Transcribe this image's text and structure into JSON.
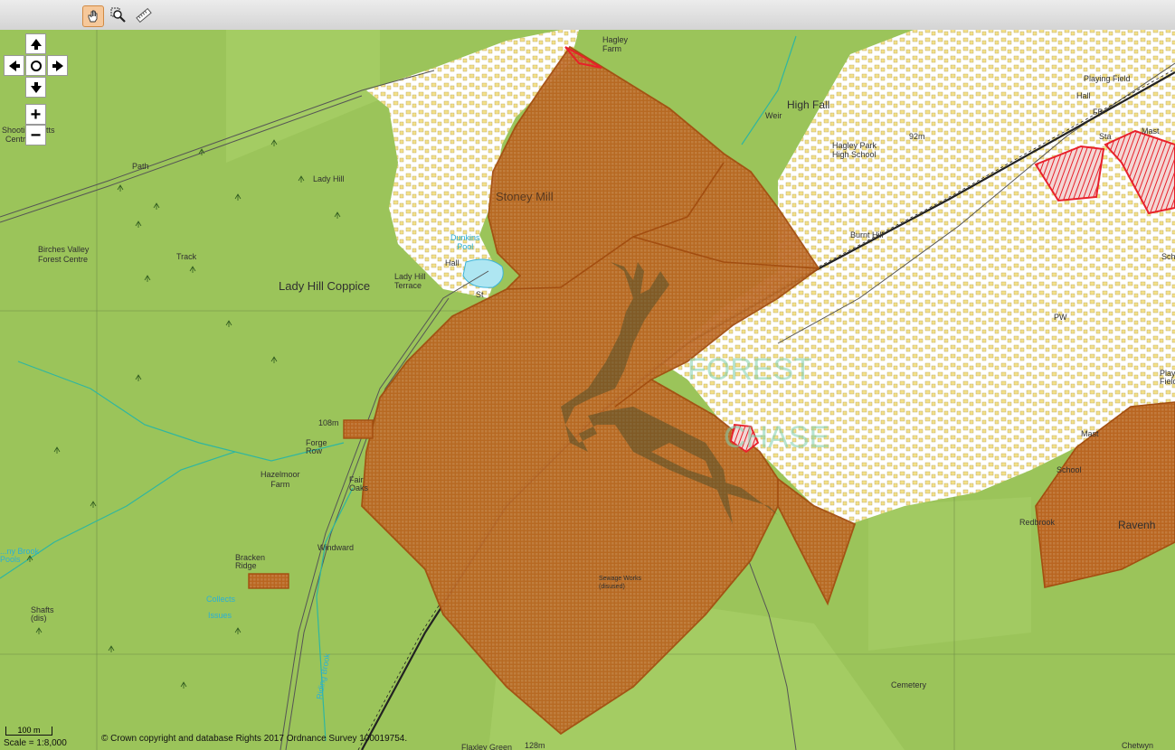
{
  "toolbar": {
    "tools": [
      {
        "name": "pan-hand-icon",
        "active": true
      },
      {
        "name": "zoom-box-icon",
        "active": false
      },
      {
        "name": "measure-ruler-icon",
        "active": false
      }
    ]
  },
  "navigation": {
    "up": "pan-up-arrow-icon",
    "down": "pan-down-arrow-icon",
    "left": "pan-left-arrow-icon",
    "right": "pan-right-arrow-icon",
    "center": "recenter-circle-icon",
    "zoom_in": "+",
    "zoom_out": "−"
  },
  "map": {
    "colors": {
      "forest": "#9bc45a",
      "urban": "#ffffff",
      "building": "#f3e08a",
      "hatch_brown": "#b5560f",
      "hatch_red": "#e8202a",
      "water": "#aee6f2"
    },
    "labels": {
      "shooting_butts": "Shooting Butts",
      "centre": "Centre",
      "lady_hill": "Lady Hill",
      "birches_valley": "Birches Valley",
      "forest_centre": "Forest Centre",
      "lady_hill_coppice": "Lady Hill Coppice",
      "lady_hill_terrace": "Lady Hill\nTerrace",
      "stoney_mill": "Stoney Mill",
      "hagley_farm": "Hagley\nFarm",
      "high_fall": "High Fall",
      "weir": "Weir",
      "hagley_park_school": "Hagley Park\nHigh School",
      "burnt_hill": "Burnt Hill",
      "playing_field": "Playing Field",
      "hall_ne": "Hall",
      "sta": "Sta",
      "mast_ne": "Mast",
      "fb": "FB",
      "dunkins_pool": "Dunkins\nPool",
      "hall_w": "Hall",
      "hazelmoor_farm": "Hazelmoor\nFarm",
      "forge_row": "Forge\nRow",
      "fair_oaks": "Fair\nOaks",
      "windward": "Windward",
      "bracken_ridge": "Bracken\nRidge",
      "collects": "Collects",
      "issues": "Issues",
      "shafts": "Shafts\n(dis)",
      "brook_pools": "...ny Brook\nPools",
      "track": "Track",
      "path": "Path",
      "m108": "108m",
      "m92": "92m",
      "m128": "128m",
      "mast_se": "Mast",
      "school_se": "School",
      "redbrook": "Redbrook",
      "cemetery": "Cemetery",
      "riding_brook": "Riding Brook",
      "flaxley_green": "Flaxley Green",
      "chetwynd": "Chetwyn",
      "sewage": "Sewage Works\n(disused)",
      "ravenhill": "Ravenh",
      "playing_e": "Playi\nField",
      "sch_e": "Sch",
      "pw": "PW",
      "st": "St",
      "hill_mark": "Hill"
    }
  },
  "scale": {
    "bar_label": "100 m",
    "text": "Scale = 1:8,000"
  },
  "copyright": "© Crown copyright and database Rights 2017 Ordnance Survey 100019754."
}
